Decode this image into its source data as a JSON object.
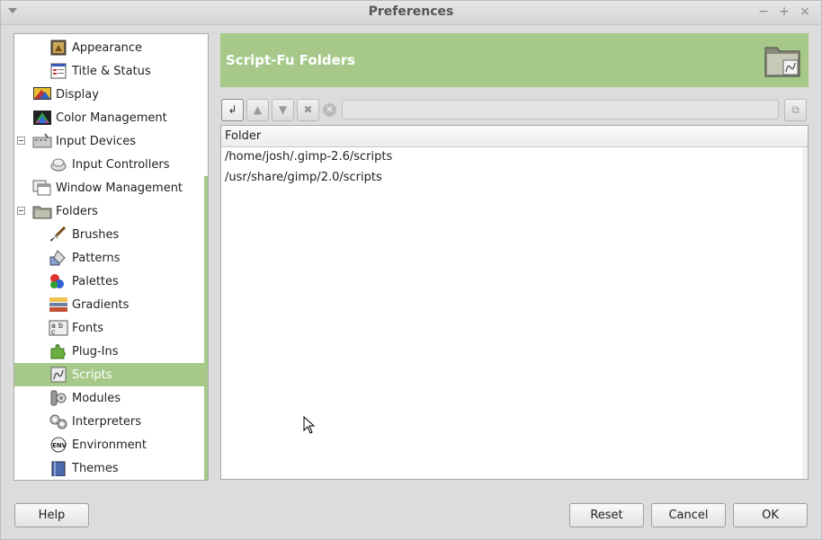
{
  "window": {
    "title": "Preferences",
    "min_glyph": "−",
    "max_glyph": "+",
    "close_glyph": "×"
  },
  "tree": {
    "items": [
      {
        "label": "Appearance",
        "icon": "appearance-icon"
      },
      {
        "label": "Title & Status",
        "icon": "title-status-icon"
      },
      {
        "label": "Display",
        "icon": "display-icon"
      },
      {
        "label": "Color Management",
        "icon": "color-management-icon"
      },
      {
        "label": "Input Devices",
        "icon": "input-devices-icon"
      },
      {
        "label": "Input Controllers",
        "icon": "input-controllers-icon"
      },
      {
        "label": "Window Management",
        "icon": "window-management-icon"
      },
      {
        "label": "Folders",
        "icon": "folders-icon"
      },
      {
        "label": "Brushes",
        "icon": "brush-icon"
      },
      {
        "label": "Patterns",
        "icon": "patterns-icon"
      },
      {
        "label": "Palettes",
        "icon": "palettes-icon"
      },
      {
        "label": "Gradients",
        "icon": "gradients-icon"
      },
      {
        "label": "Fonts",
        "icon": "fonts-icon"
      },
      {
        "label": "Plug-Ins",
        "icon": "plugin-icon"
      },
      {
        "label": "Scripts",
        "icon": "scripts-icon"
      },
      {
        "label": "Modules",
        "icon": "modules-icon"
      },
      {
        "label": "Interpreters",
        "icon": "interpreters-icon"
      },
      {
        "label": "Environment",
        "icon": "environment-icon"
      },
      {
        "label": "Themes",
        "icon": "themes-icon"
      }
    ],
    "selected": "Scripts"
  },
  "banner": {
    "title": "Script-Fu Folders",
    "icon": "folder-scripts-icon"
  },
  "toolbar": {
    "add_glyph": "↲",
    "up_glyph": "▲",
    "down_glyph": "▼",
    "delete_glyph": "✖",
    "clear_glyph": "✕",
    "path_value": "",
    "browse_glyph": "⧉"
  },
  "folders": {
    "column_header": "Folder",
    "rows": [
      "/home/josh/.gimp-2.6/scripts",
      "/usr/share/gimp/2.0/scripts"
    ]
  },
  "buttons": {
    "help": "Help",
    "reset": "Reset",
    "cancel": "Cancel",
    "ok": "OK"
  },
  "colors": {
    "accent_green": "#a6c98a"
  }
}
